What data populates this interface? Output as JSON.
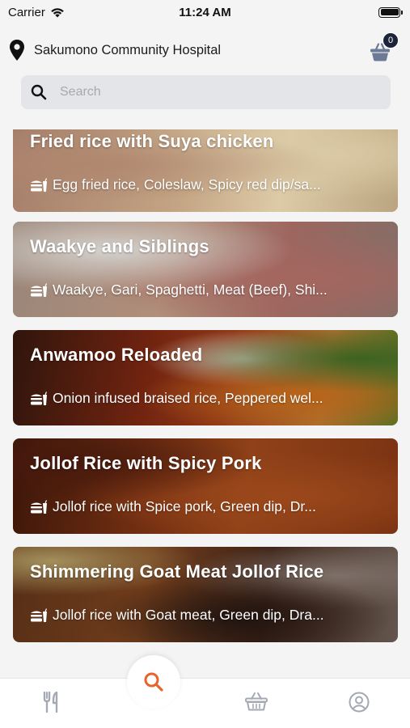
{
  "status_bar": {
    "carrier": "Carrier",
    "time": "11:24 AM"
  },
  "header": {
    "location": "Sakumono Community Hospital",
    "cart_count": "0"
  },
  "search": {
    "placeholder": "Search",
    "value": ""
  },
  "meals": [
    {
      "title": "Fried rice with Suya chicken",
      "description": "Egg fried rice, Coleslaw, Spicy red dip/sa...",
      "faded": true
    },
    {
      "title": "Waakye and Siblings",
      "description": "Waakye, Gari, Spaghetti, Meat (Beef), Shi...",
      "faded": true
    },
    {
      "title": "Anwamoo Reloaded",
      "description": "Onion infused braised rice, Peppered wel...",
      "faded": false
    },
    {
      "title": "Jollof Rice with Spicy Pork",
      "description": "Jollof rice with Spice pork, Green dip, Dr...",
      "faded": false
    },
    {
      "title": "Shimmering Goat Meat Jollof Rice",
      "description": "Jollof rice with Goat meat, Green dip, Dra...",
      "faded": false
    }
  ],
  "bottom_nav": {
    "items": [
      "restaurant-icon",
      "search-icon",
      "basket-icon",
      "profile-icon"
    ],
    "active": "search",
    "accent_color": "#e8622c"
  },
  "colors": {
    "badge": "#1d2438",
    "search_bg": "#e4e5e8"
  }
}
